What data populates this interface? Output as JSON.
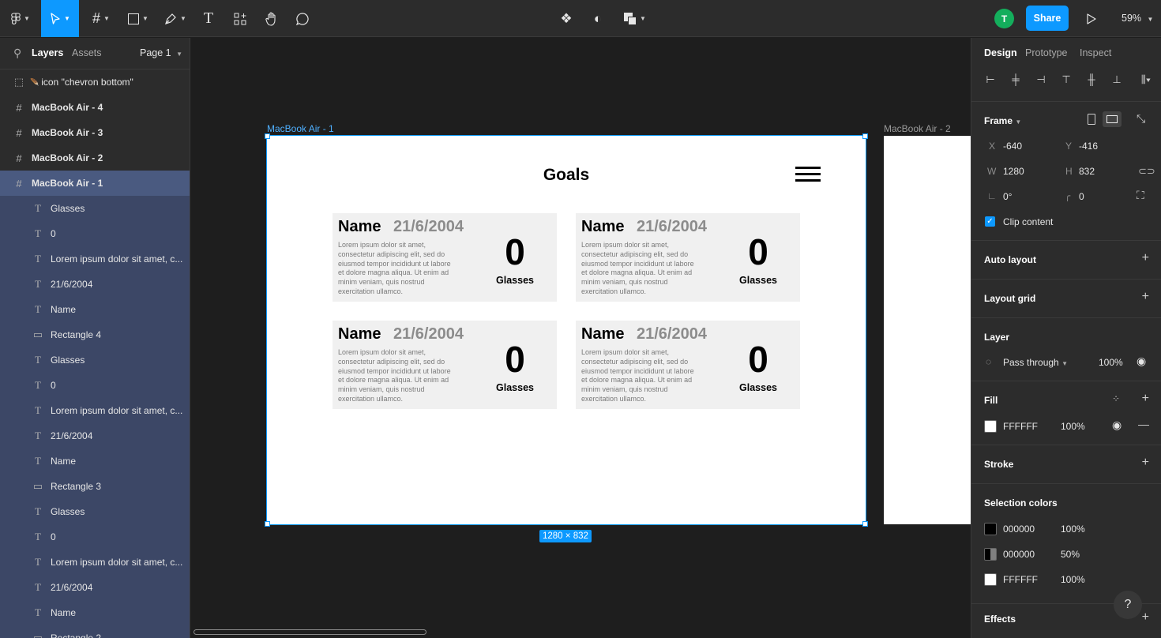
{
  "toolbar": {
    "zoom": "59%",
    "share_label": "Share",
    "avatar_initial": "T"
  },
  "left_panel": {
    "tabs": {
      "layers": "Layers",
      "assets": "Assets",
      "page": "Page 1"
    },
    "layers": [
      {
        "label": "icon \"chevron bottom\"",
        "type": "component"
      },
      {
        "label": "MacBook Air - 4",
        "type": "frame"
      },
      {
        "label": "MacBook Air - 3",
        "type": "frame"
      },
      {
        "label": "MacBook Air - 2",
        "type": "frame"
      },
      {
        "label": "MacBook Air - 1",
        "type": "frame",
        "selected": true
      },
      {
        "label": "Glasses",
        "type": "text"
      },
      {
        "label": "0",
        "type": "text"
      },
      {
        "label": "Lorem ipsum dolor sit amet, c...",
        "type": "text"
      },
      {
        "label": "21/6/2004",
        "type": "text"
      },
      {
        "label": "Name",
        "type": "text"
      },
      {
        "label": "Rectangle 4",
        "type": "rect"
      },
      {
        "label": "Glasses",
        "type": "text"
      },
      {
        "label": "0",
        "type": "text"
      },
      {
        "label": "Lorem ipsum dolor sit amet, c...",
        "type": "text"
      },
      {
        "label": "21/6/2004",
        "type": "text"
      },
      {
        "label": "Name",
        "type": "text"
      },
      {
        "label": "Rectangle 3",
        "type": "rect"
      },
      {
        "label": "Glasses",
        "type": "text"
      },
      {
        "label": "0",
        "type": "text"
      },
      {
        "label": "Lorem ipsum dolor sit amet, c...",
        "type": "text"
      },
      {
        "label": "21/6/2004",
        "type": "text"
      },
      {
        "label": "Name",
        "type": "text"
      },
      {
        "label": "Rectangle 2",
        "type": "rect"
      }
    ]
  },
  "canvas": {
    "frame1_label": "MacBook Air - 1",
    "frame2_label": "MacBook Air - 2",
    "size_badge": "1280 × 832",
    "page_title": "Goals",
    "cards": [
      {
        "name": "Name",
        "date": "21/6/2004",
        "text": "Lorem ipsum dolor sit amet, consectetur adipiscing elit, sed do eiusmod tempor incididunt ut labore et dolore magna aliqua. Ut enim ad minim veniam, quis nostrud exercitation ullamco.",
        "count": "0",
        "unit": "Glasses"
      },
      {
        "name": "Name",
        "date": "21/6/2004",
        "text": "Lorem ipsum dolor sit amet, consectetur adipiscing elit, sed do eiusmod tempor incididunt ut labore et dolore magna aliqua. Ut enim ad minim veniam, quis nostrud exercitation ullamco.",
        "count": "0",
        "unit": "Glasses"
      },
      {
        "name": "Name",
        "date": "21/6/2004",
        "text": "Lorem ipsum dolor sit amet, consectetur adipiscing elit, sed do eiusmod tempor incididunt ut labore et dolore magna aliqua. Ut enim ad minim veniam, quis nostrud exercitation ullamco.",
        "count": "0",
        "unit": "Glasses"
      },
      {
        "name": "Name",
        "date": "21/6/2004",
        "text": "Lorem ipsum dolor sit amet, consectetur adipiscing elit, sed do eiusmod tempor incididunt ut labore et dolore magna aliqua. Ut enim ad minim veniam, quis nostrud exercitation ullamco.",
        "count": "0",
        "unit": "Glasses"
      }
    ]
  },
  "right_panel": {
    "tabs": {
      "design": "Design",
      "prototype": "Prototype",
      "inspect": "Inspect"
    },
    "frame": {
      "title": "Frame",
      "x_label": "X",
      "x": "-640",
      "y_label": "Y",
      "y": "-416",
      "w_label": "W",
      "w": "1280",
      "h_label": "H",
      "h": "832",
      "rotation": "0°",
      "radius": "0",
      "clip_content": "Clip content"
    },
    "auto_layout": "Auto layout",
    "layout_grid": "Layout grid",
    "layer": {
      "title": "Layer",
      "blend": "Pass through",
      "opacity": "100%"
    },
    "fill": {
      "title": "Fill",
      "hex": "FFFFFF",
      "opacity": "100%"
    },
    "stroke": "Stroke",
    "selection_colors": {
      "title": "Selection colors",
      "items": [
        {
          "hex": "000000",
          "opacity": "100%"
        },
        {
          "hex": "000000",
          "opacity": "50%"
        },
        {
          "hex": "FFFFFF",
          "opacity": "100%"
        }
      ]
    },
    "effects": "Effects"
  },
  "colors": {
    "accent": "#0d99ff",
    "avatar": "#14ae5c"
  }
}
